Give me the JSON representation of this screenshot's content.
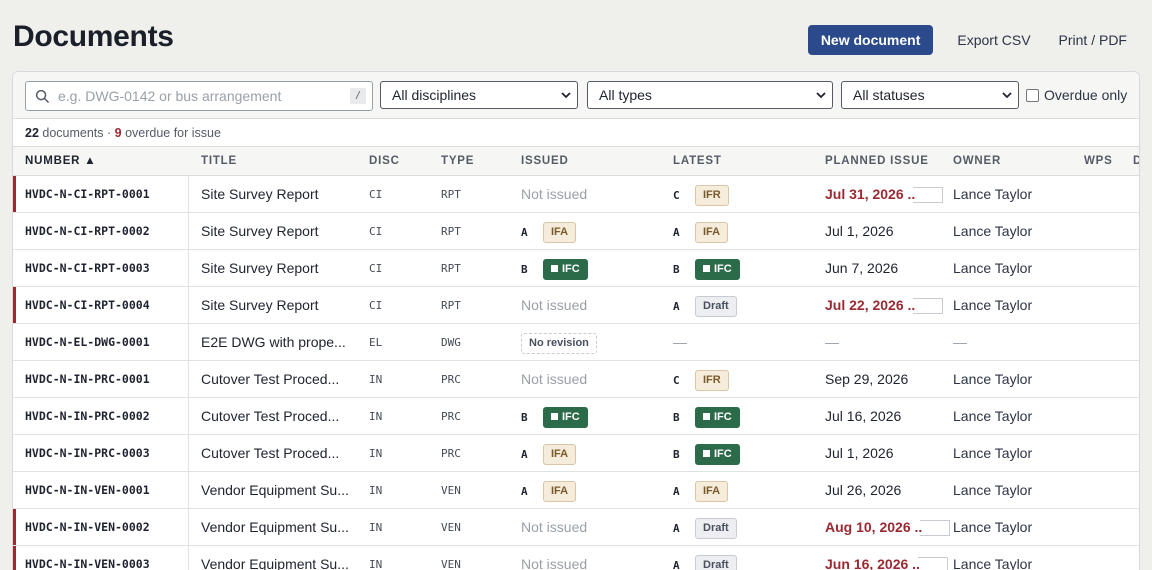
{
  "page": {
    "title": "Documents",
    "new_label": "New document",
    "export_label": "Export CSV",
    "print_label": "Print / PDF"
  },
  "filters": {
    "search_placeholder": "e.g. DWG-0142 or bus arrangement",
    "search_shortcut": "/",
    "discipline": "All disciplines",
    "type": "All types",
    "status": "All statuses",
    "overdue_label": "Overdue only"
  },
  "summary": {
    "count": "22",
    "count_suffix": " documents",
    "sep": " · ",
    "overdue": "9",
    "overdue_suffix": " overdue for issue"
  },
  "columns": {
    "number": "NUMBER ▲",
    "title": "TITLE",
    "disc": "DISC",
    "type": "TYPE",
    "issued": "ISSUED",
    "latest": "LATEST",
    "planned": "PLANNED ISSUE",
    "owner": "OWNER",
    "wps": "WPS",
    "extra": "D"
  },
  "rows": [
    {
      "number": "HVDC-N-CI-RPT-0001",
      "title": "Site Survey Report",
      "disc": "CI",
      "type": "RPT",
      "issued_rev": "",
      "issued_status": "Not issued",
      "latest_rev": "C",
      "latest_status": "IFR",
      "planned": "Jul 31, 2026",
      "planned_overdue": true,
      "owner": "Lance Taylor"
    },
    {
      "number": "HVDC-N-CI-RPT-0002",
      "title": "Site Survey Report",
      "disc": "CI",
      "type": "RPT",
      "issued_rev": "A",
      "issued_status": "IFA",
      "latest_rev": "A",
      "latest_status": "IFA",
      "planned": "Jul 1, 2026",
      "planned_overdue": false,
      "owner": "Lance Taylor"
    },
    {
      "number": "HVDC-N-CI-RPT-0003",
      "title": "Site Survey Report",
      "disc": "CI",
      "type": "RPT",
      "issued_rev": "B",
      "issued_status": "IFC",
      "latest_rev": "B",
      "latest_status": "IFC",
      "planned": "Jun 7, 2026",
      "planned_overdue": false,
      "owner": "Lance Taylor"
    },
    {
      "number": "HVDC-N-CI-RPT-0004",
      "title": "Site Survey Report",
      "disc": "CI",
      "type": "RPT",
      "issued_rev": "",
      "issued_status": "Not issued",
      "latest_rev": "A",
      "latest_status": "Draft",
      "planned": "Jul 22, 2026",
      "planned_overdue": true,
      "owner": "Lance Taylor"
    },
    {
      "number": "HVDC-N-EL-DWG-0001",
      "title": "E2E DWG with prope...",
      "disc": "EL",
      "type": "DWG",
      "issued_rev": "",
      "issued_status": "No revision",
      "latest_rev": "",
      "latest_status": "—",
      "planned": "—",
      "planned_overdue": false,
      "owner": "—"
    },
    {
      "number": "HVDC-N-IN-PRC-0001",
      "title": "Cutover Test Proced...",
      "disc": "IN",
      "type": "PRC",
      "issued_rev": "",
      "issued_status": "Not issued",
      "latest_rev": "C",
      "latest_status": "IFR",
      "planned": "Sep 29, 2026",
      "planned_overdue": false,
      "owner": "Lance Taylor"
    },
    {
      "number": "HVDC-N-IN-PRC-0002",
      "title": "Cutover Test Proced...",
      "disc": "IN",
      "type": "PRC",
      "issued_rev": "B",
      "issued_status": "IFC",
      "latest_rev": "B",
      "latest_status": "IFC",
      "planned": "Jul 16, 2026",
      "planned_overdue": false,
      "owner": "Lance Taylor"
    },
    {
      "number": "HVDC-N-IN-PRC-0003",
      "title": "Cutover Test Proced...",
      "disc": "IN",
      "type": "PRC",
      "issued_rev": "A",
      "issued_status": "IFA",
      "latest_rev": "B",
      "latest_status": "IFC",
      "planned": "Jul 1, 2026",
      "planned_overdue": false,
      "owner": "Lance Taylor"
    },
    {
      "number": "HVDC-N-IN-VEN-0001",
      "title": "Vendor Equipment Su...",
      "disc": "IN",
      "type": "VEN",
      "issued_rev": "A",
      "issued_status": "IFA",
      "latest_rev": "A",
      "latest_status": "IFA",
      "planned": "Jul 26, 2026",
      "planned_overdue": false,
      "owner": "Lance Taylor"
    },
    {
      "number": "HVDC-N-IN-VEN-0002",
      "title": "Vendor Equipment Su...",
      "disc": "IN",
      "type": "VEN",
      "issued_rev": "",
      "issued_status": "Not issued",
      "latest_rev": "A",
      "latest_status": "Draft",
      "planned": "Aug 10, 2026",
      "planned_overdue": true,
      "owner": "Lance Taylor"
    },
    {
      "number": "HVDC-N-IN-VEN-0003",
      "title": "Vendor Equipment Su...",
      "disc": "IN",
      "type": "VEN",
      "issued_rev": "",
      "issued_status": "Not issued",
      "latest_rev": "A",
      "latest_status": "Draft",
      "planned": "Jun 16, 2026",
      "planned_overdue": true,
      "owner": "Lance Taylor"
    }
  ],
  "colors": {
    "primary": "#2a4a8c",
    "overdue": "#9a2a32",
    "ifc": "#2c6b4a"
  }
}
